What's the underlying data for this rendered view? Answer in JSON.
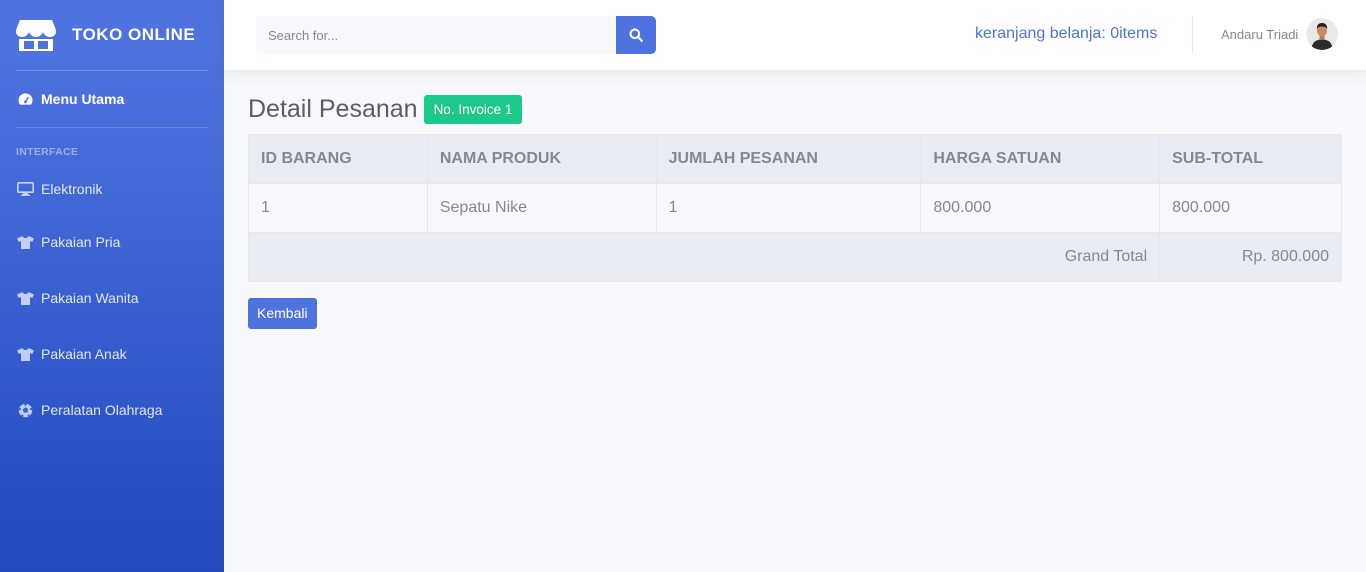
{
  "sidebar": {
    "brand": "TOKO ONLINE",
    "main_item": "Menu Utama",
    "heading": "INTERFACE",
    "items": [
      {
        "label": "Elektronik",
        "icon": "desktop-icon"
      },
      {
        "label": "Pakaian Pria",
        "icon": "tshirt-icon"
      },
      {
        "label": "Pakaian Wanita",
        "icon": "tshirt-icon"
      },
      {
        "label": "Pakaian Anak",
        "icon": "tshirt-icon"
      },
      {
        "label": "Peralatan Olahraga",
        "icon": "futbol-icon"
      }
    ]
  },
  "topbar": {
    "search_placeholder": "Search for...",
    "cart_text": "keranjang belanja: 0items",
    "user_name": "Andaru Triadi"
  },
  "main": {
    "title": "Detail Pesanan",
    "badge": "No. Invoice 1",
    "table": {
      "headers": [
        "ID BARANG",
        "NAMA PRODUK",
        "JUMLAH PESANAN",
        "HARGA SATUAN",
        "SUB-TOTAL"
      ],
      "rows": [
        [
          "1",
          "Sepatu Nike",
          "1",
          "800.000",
          "800.000"
        ]
      ],
      "total_label": "Grand Total",
      "total_value": "Rp. 800.000"
    },
    "back_label": "Kembali"
  },
  "colors": {
    "primary": "#4e73df",
    "success": "#1cc88a"
  }
}
